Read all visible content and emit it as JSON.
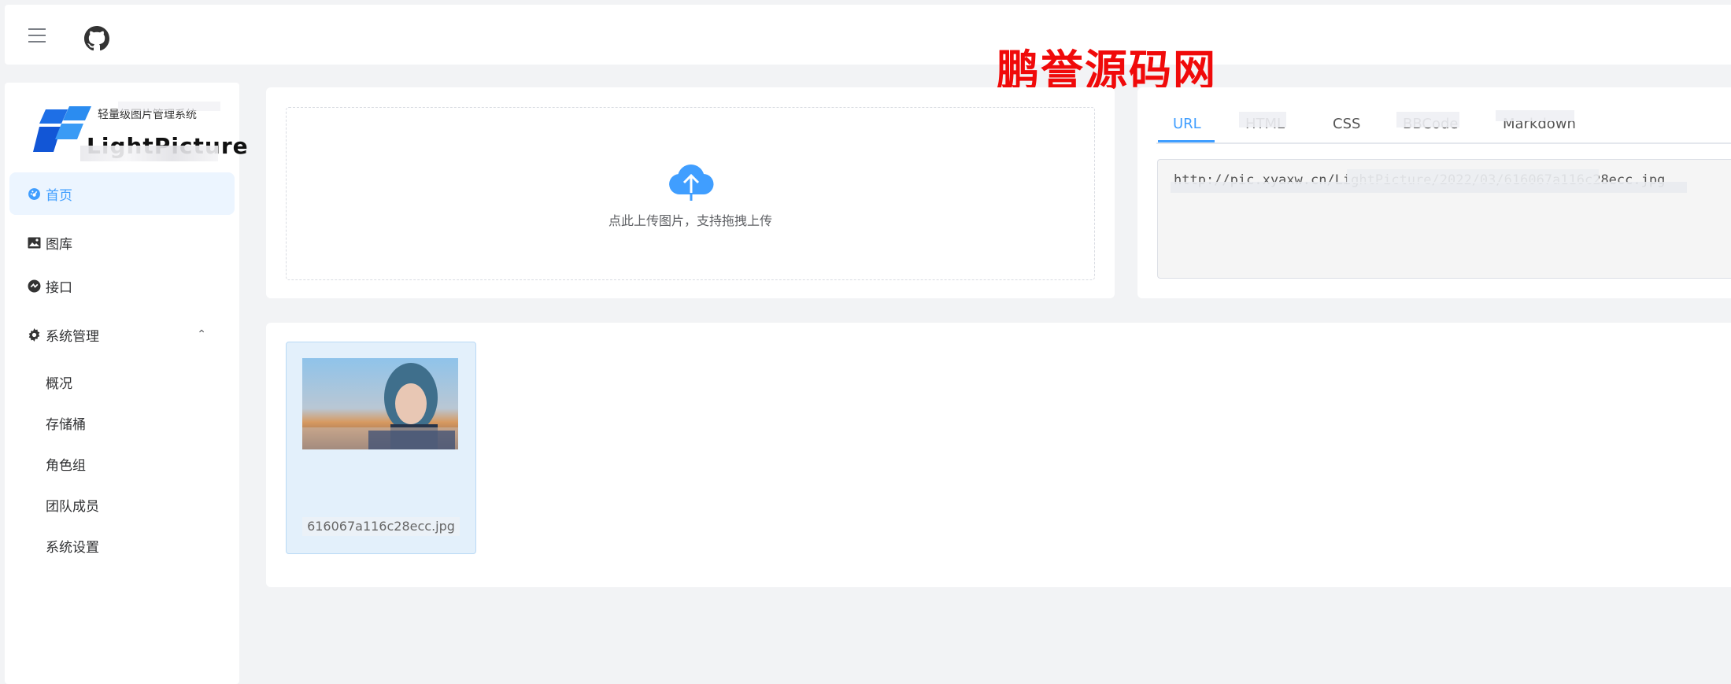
{
  "topbar": {
    "menu_icon": "hamburger-icon",
    "github_icon": "github-icon"
  },
  "watermark": "鹏誉源码网",
  "sidebar": {
    "logo": {
      "subtitle": "轻量级图片管理系统",
      "name": "LightPicture"
    },
    "items": [
      {
        "label": "首页",
        "icon": "dashboard-icon",
        "active": true
      },
      {
        "label": "图库",
        "icon": "picture-icon",
        "active": false
      },
      {
        "label": "接口",
        "icon": "api-icon",
        "active": false
      },
      {
        "label": "系统管理",
        "icon": "gear-icon",
        "active": false,
        "expanded": true
      }
    ],
    "sub_items": [
      "概况",
      "存储桶",
      "角色组",
      "团队成员",
      "系统设置"
    ]
  },
  "upload": {
    "icon": "cloud-upload-icon",
    "text": "点此上传图片，支持拖拽上传"
  },
  "link_panel": {
    "tabs": [
      "URL",
      "HTML",
      "CSS",
      "BBCode",
      "Markdown"
    ],
    "active_tab": "URL",
    "url_value": "http://pic.xyaxw.cn/LightPicture/2022/03/616067a116c28ecc.jpg"
  },
  "gallery": {
    "items": [
      {
        "filename": "616067a116c28ecc.jpg"
      }
    ]
  },
  "colors": {
    "accent": "#409eff",
    "active_bg": "#ecf5ff",
    "page_bg": "#f2f3f5",
    "watermark": "#f00a0a"
  }
}
